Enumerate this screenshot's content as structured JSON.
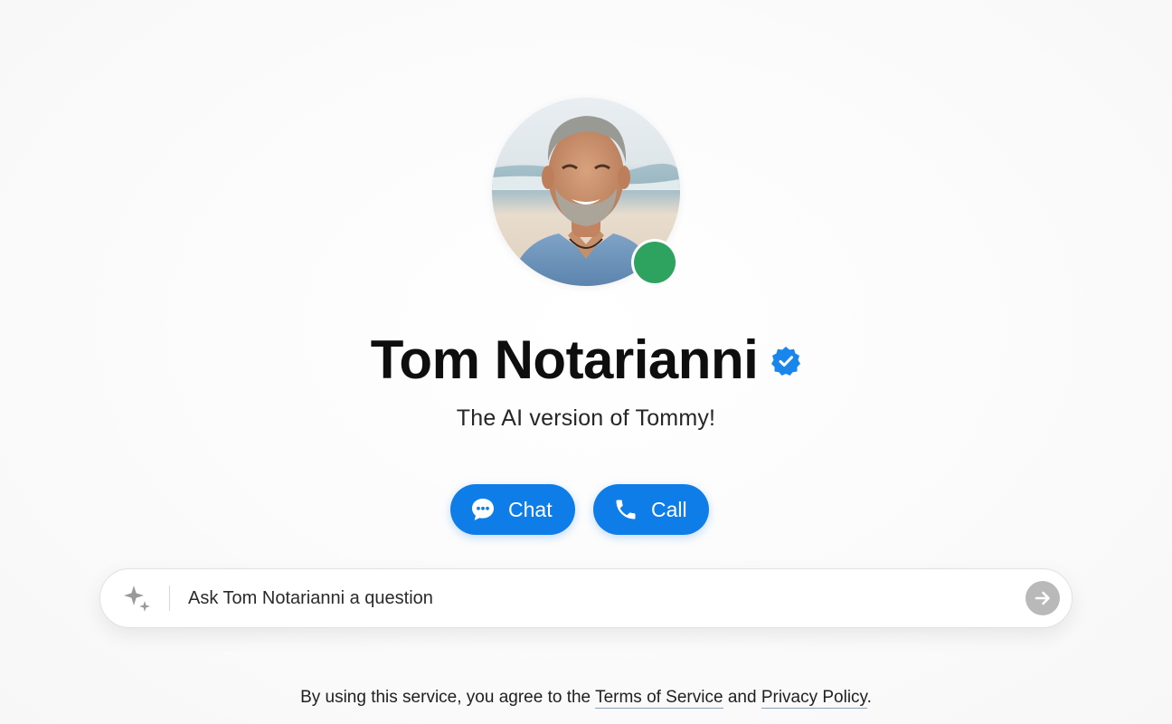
{
  "profile": {
    "name": "Tom Notarianni",
    "tagline": "The AI version of Tommy!",
    "verified_icon": "verified-badge-icon",
    "status": "online",
    "status_color": "#2ea35f",
    "avatar_alt": "Tom Notarianni"
  },
  "actions": {
    "chat_label": "Chat",
    "chat_icon": "chat-bubble-icon",
    "call_label": "Call",
    "call_icon": "phone-icon"
  },
  "ask": {
    "placeholder": "Ask Tom Notarianni a question",
    "left_icon": "sparkle-icon",
    "send_icon": "arrow-right-icon"
  },
  "footer": {
    "prefix": "By using this service, you agree to the ",
    "terms_label": "Terms of Service",
    "middle": " and ",
    "privacy_label": "Privacy Policy",
    "suffix": "."
  },
  "colors": {
    "accent": "#0f7de8",
    "status_online": "#2ea35f",
    "send_button": "#b9b9b9",
    "background": "#fafafa"
  }
}
